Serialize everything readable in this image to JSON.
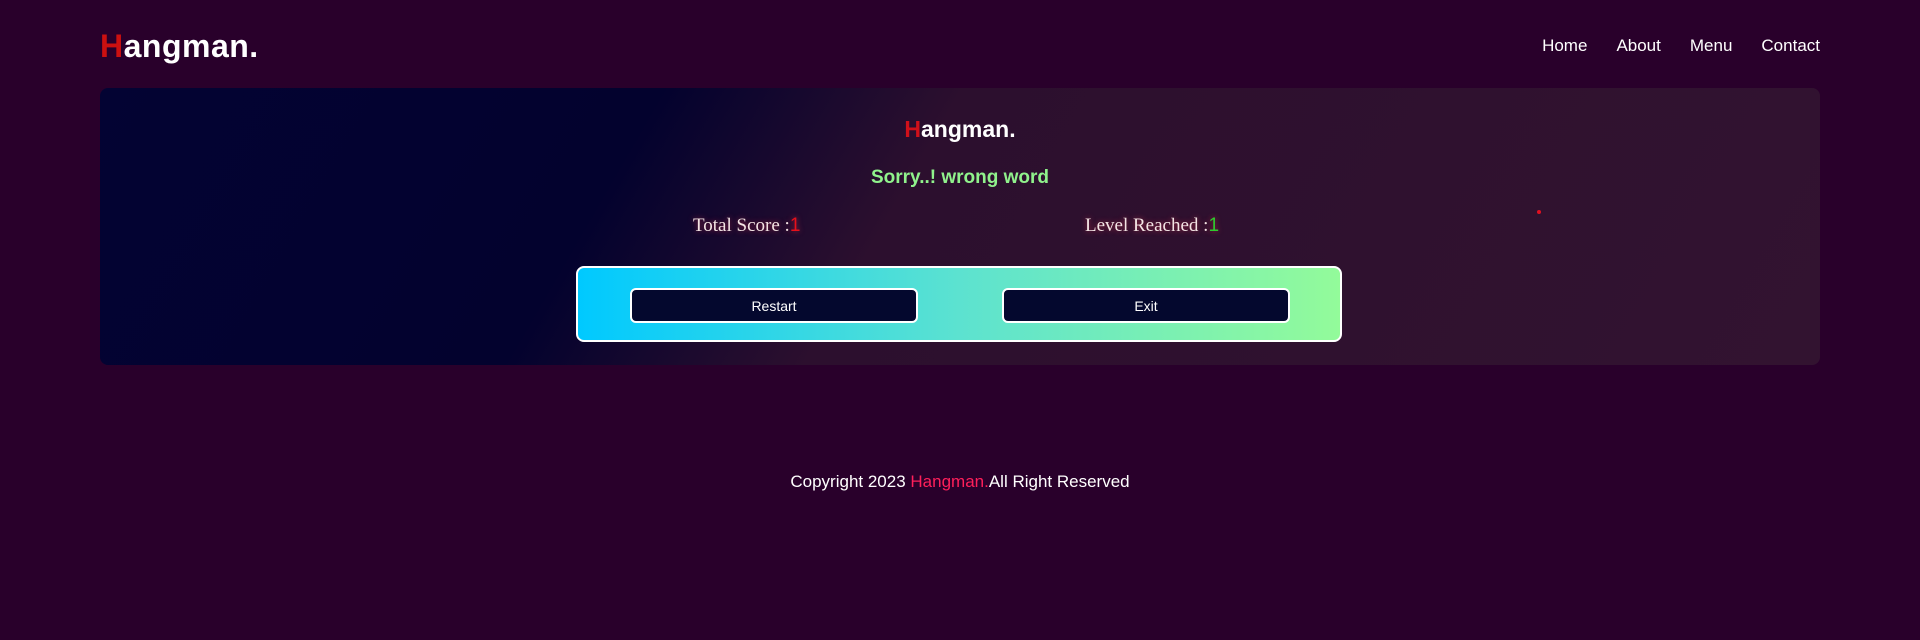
{
  "header": {
    "logo_first": "H",
    "logo_rest": "angman.",
    "nav": [
      "Home",
      "About",
      "Menu",
      "Contact"
    ]
  },
  "game": {
    "title_first": "H",
    "title_rest": "angman.",
    "message": "Sorry..! wrong word",
    "score_label": "Total Score :",
    "score_value": "1",
    "level_label": "Level Reached :",
    "level_value": "1",
    "restart_label": "Restart",
    "exit_label": "Exit"
  },
  "footer": {
    "prefix": "Copyright 2023 ",
    "brand": "Hangman.",
    "suffix": "All Right Reserved"
  },
  "colors": {
    "background": "#29002b",
    "accent_red": "#cc1010",
    "message_green": "#90f28c",
    "footer_brand": "#ff1f5a"
  }
}
